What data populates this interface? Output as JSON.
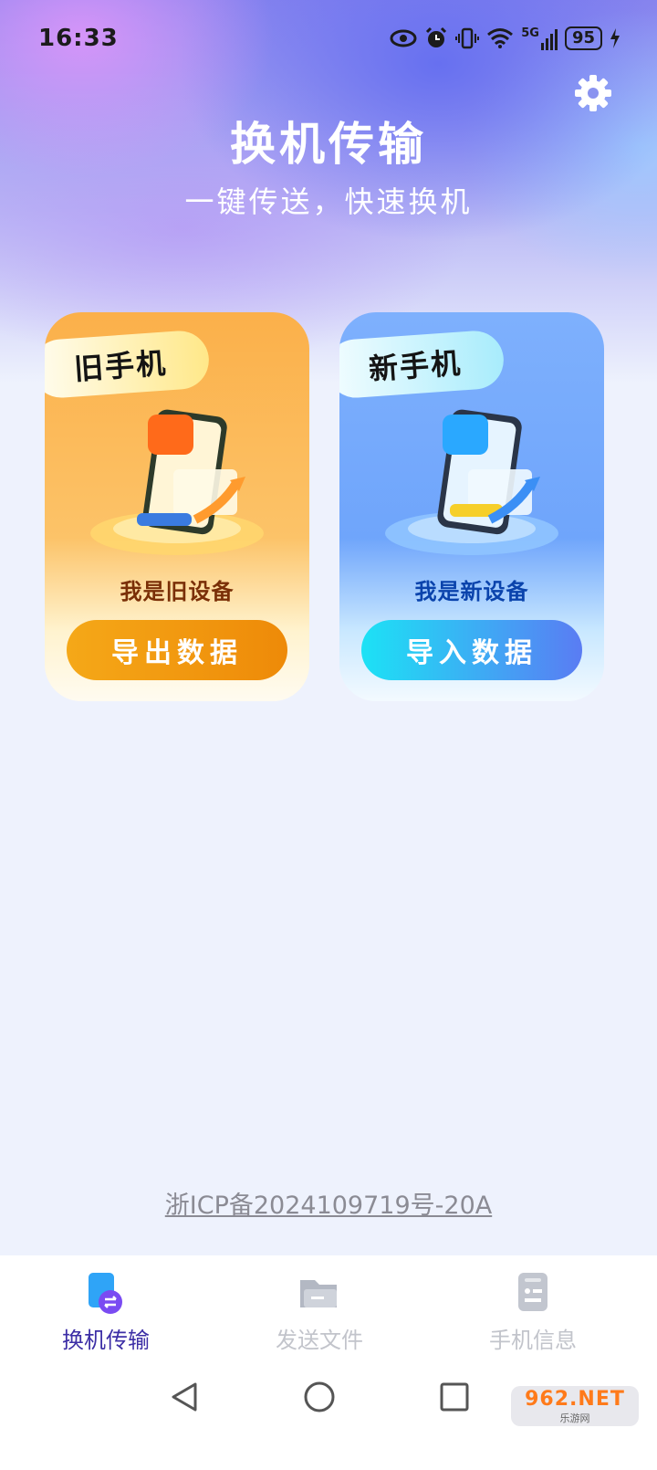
{
  "status_bar": {
    "time": "16:33",
    "icons": [
      "eye-icon",
      "alarm-icon",
      "vibrate-icon",
      "wifi-icon",
      "signal-5g-icon"
    ],
    "network_label": "5G",
    "battery": "95"
  },
  "header": {
    "title": "换机传输",
    "subtitle": "一键传送，快速换机",
    "settings_icon": "gear-icon"
  },
  "cards": {
    "old": {
      "tag": "旧手机",
      "label": "我是旧设备",
      "button": "导出数据",
      "accent": "#f5a818"
    },
    "new": {
      "tag": "新手机",
      "label": "我是新设备",
      "button": "导入数据",
      "accent": "#1ce2f5"
    }
  },
  "footer": {
    "icp": "浙ICP备2024109719号-20A"
  },
  "bottom_nav": {
    "items": [
      {
        "label": "换机传输",
        "icon": "transfer-icon",
        "active": true
      },
      {
        "label": "发送文件",
        "icon": "folder-icon",
        "active": false
      },
      {
        "label": "手机信息",
        "icon": "phone-info-icon",
        "active": false
      }
    ],
    "active_color": "#3d2fa6"
  },
  "watermark": {
    "top": "962.NET",
    "bottom": "乐游网"
  }
}
